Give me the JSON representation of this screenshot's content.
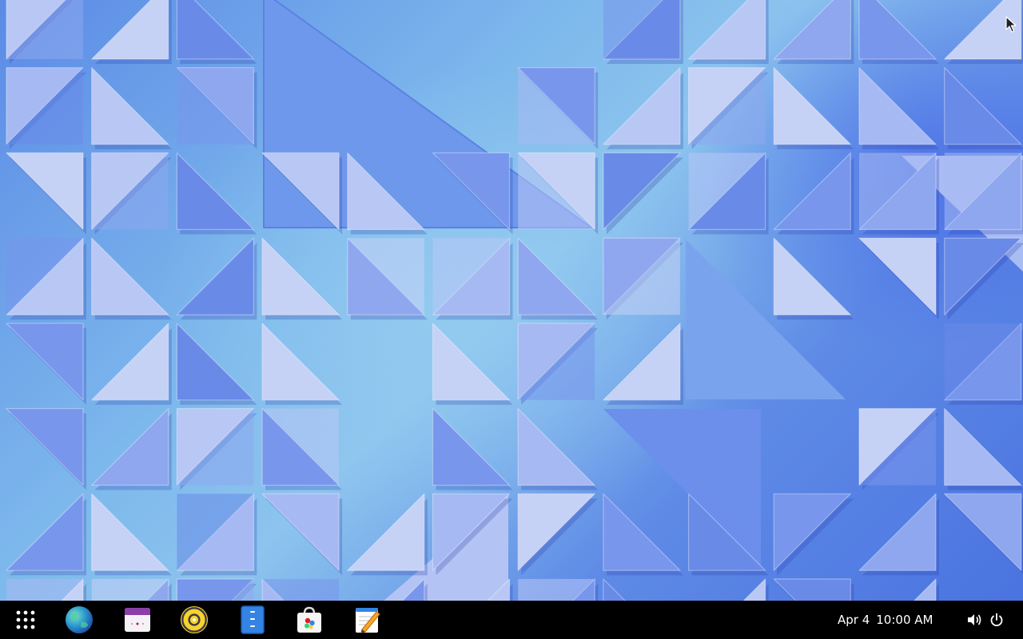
{
  "taskbar": {
    "apps": [
      {
        "name": "app-grid",
        "icon": "app-grid-icon"
      },
      {
        "name": "browser",
        "icon": "globe-icon"
      },
      {
        "name": "calendar",
        "icon": "calendar-icon"
      },
      {
        "name": "music",
        "icon": "music-disc-icon"
      },
      {
        "name": "file-manager",
        "icon": "files-icon"
      },
      {
        "name": "software-store",
        "icon": "shopping-bag-icon"
      },
      {
        "name": "text-editor",
        "icon": "text-editor-icon"
      }
    ],
    "clock": {
      "date": "Apr 4",
      "time": "10:00 AM"
    },
    "tray": {
      "volume_icon": "volume-icon",
      "power_icon": "power-icon"
    }
  },
  "colors": {
    "taskbar_bg": "#000000",
    "tile_light": "#b8c6f4",
    "tile_mid": "#7f9ef0",
    "tile_dark": "#5a7fe3"
  }
}
